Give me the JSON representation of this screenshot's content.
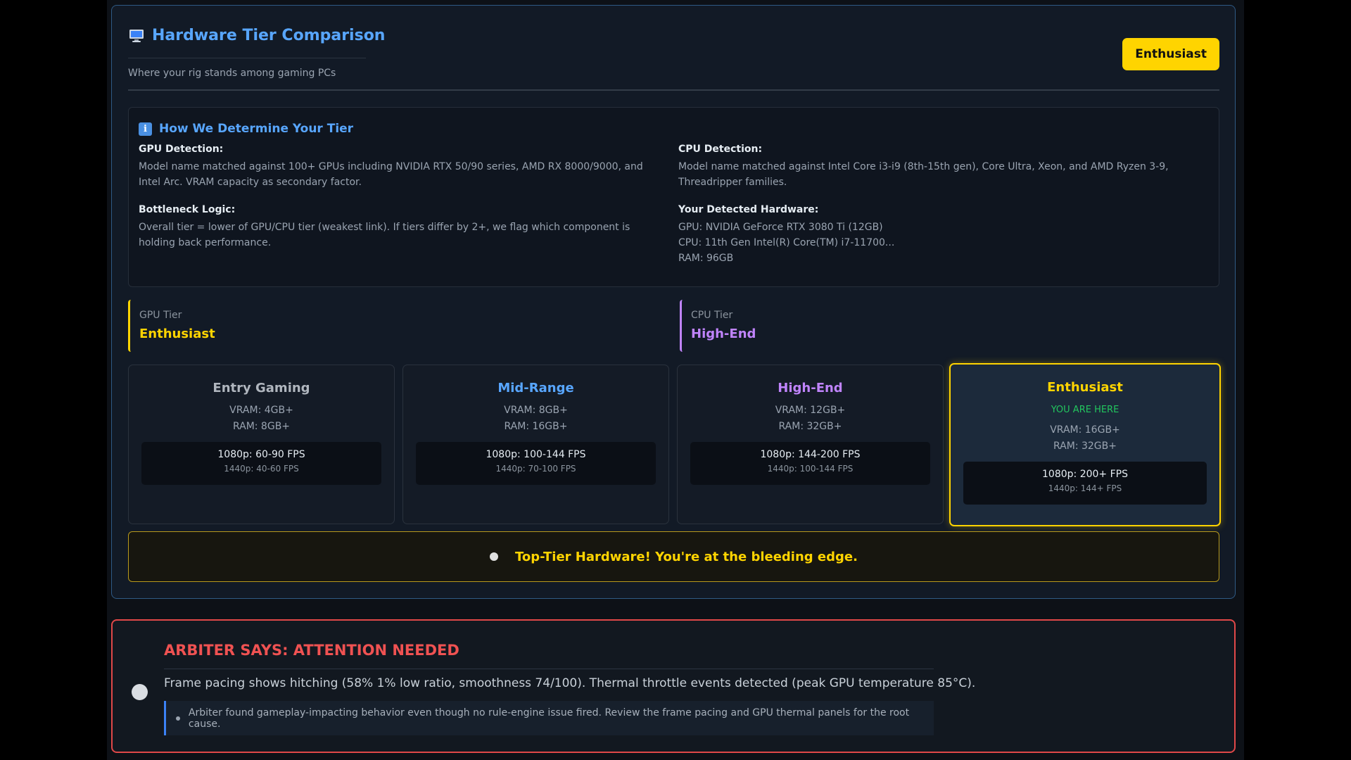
{
  "hardware": {
    "title": "Hardware Tier Comparison",
    "subtitle": "Where your rig stands among gaming PCs",
    "badge": "Enthusiast"
  },
  "info": {
    "title": "How We Determine Your Tier",
    "gpu_label": "GPU Detection:",
    "gpu_text": "Model name matched against 100+ GPUs including NVIDIA RTX 50/90 series, AMD RX 8000/9000, and Intel Arc. VRAM capacity as secondary factor.",
    "cpu_label": "CPU Detection:",
    "cpu_text": "Model name matched against Intel Core i3-i9 (8th-15th gen), Core Ultra, Xeon, and AMD Ryzen 3-9, Threadripper families.",
    "bottleneck_label": "Bottleneck Logic:",
    "bottleneck_text": "Overall tier = lower of GPU/CPU tier (weakest link). If tiers differ by 2+, we flag which component is holding back performance.",
    "detected_label": "Your Detected Hardware:",
    "detected": {
      "gpu": "GPU: NVIDIA GeForce RTX 3080 Ti (12GB)",
      "cpu": "CPU: 11th Gen Intel(R) Core(TM) i7-11700...",
      "ram": "RAM: 96GB"
    }
  },
  "component_tiers": {
    "gpu": {
      "label": "GPU Tier",
      "value": "Enthusiast"
    },
    "cpu": {
      "label": "CPU Tier",
      "value": "High-End"
    }
  },
  "tiers": [
    {
      "name": "Entry Gaming",
      "color": "#b0b6be",
      "vram": "VRAM: 4GB+",
      "ram": "RAM: 8GB+",
      "fps_1080": "1080p: 60-90 FPS",
      "fps_1440": "1440p: 40-60 FPS"
    },
    {
      "name": "Mid-Range",
      "color": "#58a6ff",
      "vram": "VRAM: 8GB+",
      "ram": "RAM: 16GB+",
      "fps_1080": "1080p: 100-144 FPS",
      "fps_1440": "1440p: 70-100 FPS"
    },
    {
      "name": "High-End",
      "color": "#c084fc",
      "vram": "VRAM: 12GB+",
      "ram": "RAM: 32GB+",
      "fps_1080": "1080p: 144-200 FPS",
      "fps_1440": "1440p: 100-144 FPS"
    },
    {
      "name": "Enthusiast",
      "color": "#ffd400",
      "here": "YOU ARE HERE",
      "vram": "VRAM: 16GB+",
      "ram": "RAM: 32GB+",
      "fps_1080": "1080p: 200+ FPS",
      "fps_1440": "1440p: 144+ FPS"
    }
  ],
  "banner": {
    "text": "Top-Tier Hardware! You're at the bleeding edge."
  },
  "arbiter": {
    "title": "ARBITER SAYS: ATTENTION NEEDED",
    "summary": "Frame pacing shows hitching (58% 1% low ratio, smoothness 74/100). Thermal throttle events detected (peak GPU temperature 85°C).",
    "note": "Arbiter found gameplay-impacting behavior even though no rule-engine issue fired. Review the frame pacing and GPU thermal panels for the root cause."
  }
}
